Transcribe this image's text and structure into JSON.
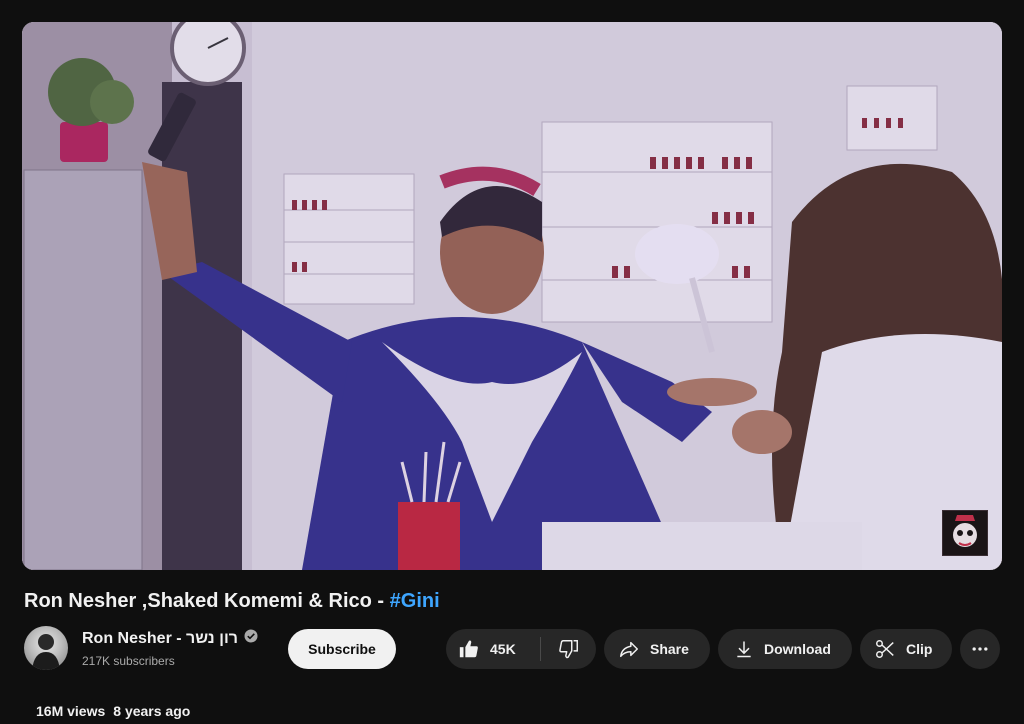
{
  "video": {
    "title_main": "Ron Nesher ,Shaked Komemi & Rico - ",
    "title_hashtag": "#Gini"
  },
  "channel": {
    "name": "Ron Nesher - רון נשר",
    "subscribers": "217K subscribers",
    "verified_icon": "verified-icon"
  },
  "actions": {
    "subscribe_label": "Subscribe",
    "like_count": "45K",
    "share_label": "Share",
    "download_label": "Download",
    "clip_label": "Clip"
  },
  "stats": {
    "views": "16M views",
    "age": "8 years ago"
  },
  "colors": {
    "background": "#0f0f0f",
    "pill": "#272727",
    "hashtag": "#3ea6ff",
    "subscribe_bg": "#f1f1f1"
  }
}
